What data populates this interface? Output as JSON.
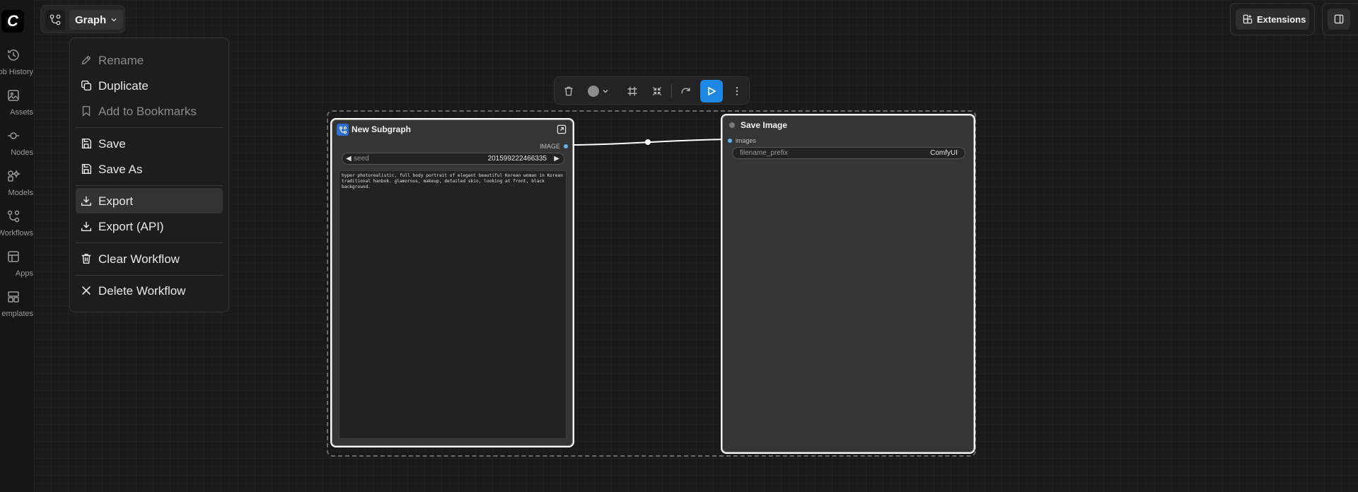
{
  "app": {
    "graph_tab_label": "Graph"
  },
  "sidebar": {
    "items": [
      {
        "label": "ob History",
        "icon": "history-icon"
      },
      {
        "label": "Assets",
        "icon": "image-icon"
      },
      {
        "label": "Nodes",
        "icon": "node-icon"
      },
      {
        "label": "Models",
        "icon": "models-icon"
      },
      {
        "label": "Workflows",
        "icon": "workflow-icon"
      },
      {
        "label": "Apps",
        "icon": "apps-icon"
      },
      {
        "label": "emplates",
        "icon": "templates-icon"
      }
    ]
  },
  "menu": {
    "items": [
      {
        "label": "Rename",
        "icon": "pencil-icon",
        "disabled": true
      },
      {
        "label": "Duplicate",
        "icon": "copy-icon"
      },
      {
        "label": "Add to Bookmarks",
        "icon": "bookmark-icon",
        "disabled": true
      },
      {
        "label": "Save",
        "icon": "save-icon"
      },
      {
        "label": "Save As",
        "icon": "save-icon"
      },
      {
        "label": "Export",
        "icon": "download-icon",
        "active": true
      },
      {
        "label": "Export (API)",
        "icon": "download-icon"
      },
      {
        "label": "Clear Workflow",
        "icon": "trash-icon"
      },
      {
        "label": "Delete Workflow",
        "icon": "close-icon"
      }
    ]
  },
  "topbar": {
    "extensions_label": "Extensions"
  },
  "nodes": {
    "subgraph": {
      "title": "New Subgraph",
      "output_label": "IMAGE",
      "seed_key": "seed",
      "seed_value": "201599222466335",
      "prompt": "hyper photorealistic, full body portrait of elegant beautiful Korean woman in Korean traditional hanbok. glamorous, makeup, detailed skin, looking at front, black background."
    },
    "save_image": {
      "title": "Save Image",
      "input_label": "images",
      "filename_key": "filename_prefix",
      "filename_value": "ComfyUI"
    }
  },
  "colors": {
    "accent": "#1e88e5",
    "link": "#64b5f6",
    "background": "#1a1a1a"
  }
}
